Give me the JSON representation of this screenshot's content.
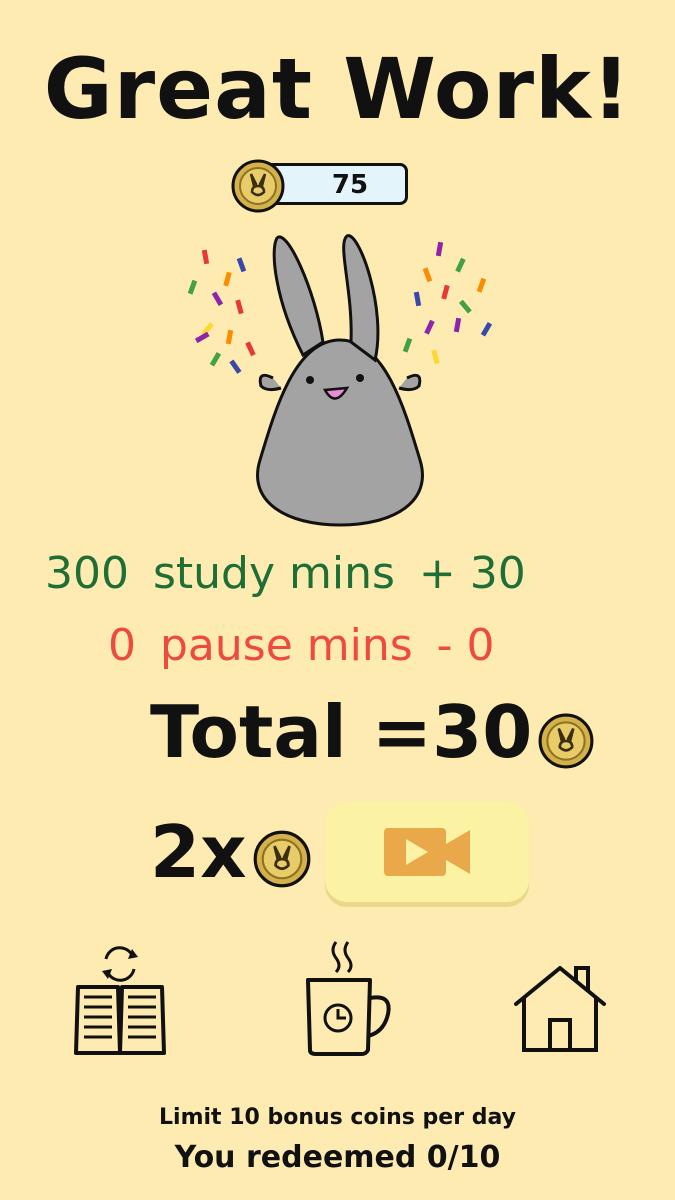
{
  "header": {
    "title": "Great Work!"
  },
  "coin_counter": {
    "count": "75",
    "icon": "coin-bunny-icon"
  },
  "summary": {
    "study": {
      "value": "300",
      "label": "study mins",
      "delta": "+ 30",
      "color": "#1E6E35"
    },
    "pause": {
      "value": "0",
      "label": "pause mins",
      "delta": "- 0",
      "color": "#EE4A3E"
    },
    "total_label": "Total =",
    "total_value": "30"
  },
  "bonus": {
    "multiplier_label": "2x",
    "video_icon": "video-camera-icon"
  },
  "nav": [
    {
      "name": "study-book-icon"
    },
    {
      "name": "break-cup-icon"
    },
    {
      "name": "home-icon"
    }
  ],
  "footer": {
    "limit_text": "Limit 10 bonus coins per day",
    "redeemed_text": "You redeemed 0/10"
  },
  "colors": {
    "background": "#FDEBB2",
    "coin": "#D4B14A",
    "video_button": "#FBF2A3",
    "video_icon": "#E9A94A"
  }
}
